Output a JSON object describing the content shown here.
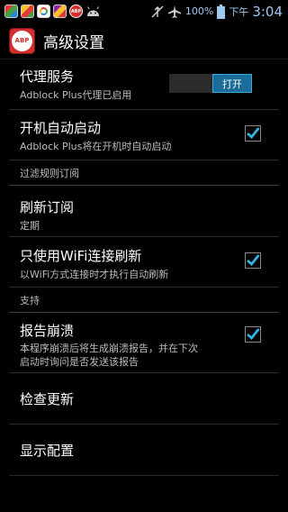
{
  "status_bar": {
    "battery": "100%",
    "ampm": "下午",
    "time": "3:04",
    "notification_icons": [
      "app-icon-1",
      "app-icon-2",
      "app-icon-3",
      "app-icon-4",
      "abp-icon",
      "android-debug-icon"
    ],
    "abp_label": "ABP"
  },
  "action_bar": {
    "title": "高级设置",
    "logo_text": "ABP"
  },
  "prefs": {
    "proxy": {
      "title": "代理服务",
      "summary": "Adblock Plus代理已启用",
      "toggle_on_label": "打开"
    },
    "autostart": {
      "title": "开机自动启动",
      "summary": "Adblock Plus将在开机时自动启动",
      "checked": true
    },
    "cat_filters": "过滤规则订阅",
    "refresh": {
      "title": "刷新订阅",
      "summary": "定期"
    },
    "wifi": {
      "title": "只使用WiFi连接刷新",
      "summary": "以WiFi方式连接时才执行自动刷新",
      "checked": true
    },
    "cat_support": "支持",
    "crash": {
      "title": "报告崩溃",
      "summary_line1": "本程序崩溃后将生成崩溃报告，并在下次",
      "summary_line2": "启动时询问是否发送该报告",
      "checked": true
    },
    "check_update": {
      "title": "检查更新"
    },
    "show_config": {
      "title": "显示配置"
    }
  },
  "colors": {
    "accent": "#33b5e5",
    "toggle_on": "#1b6c98",
    "logo_red": "#d32f2f"
  }
}
